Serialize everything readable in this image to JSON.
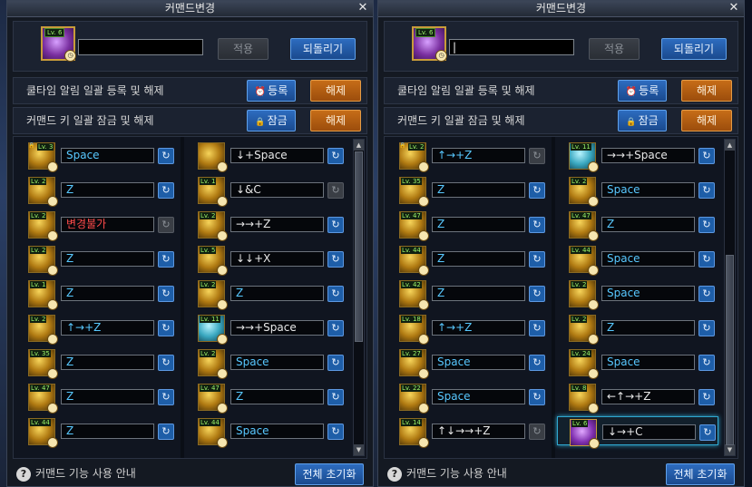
{
  "icons": {
    "close": "✕",
    "reset": "↻",
    "help": "?",
    "alarm": "⏰",
    "lock": "🔒",
    "clock": "◷"
  },
  "panels": [
    {
      "title": "커맨드변경",
      "avatar_level": "Lv. 6",
      "name_value": "",
      "apply_label": "적용",
      "revert_label": "되돌리기",
      "cooldown_label": "쿨타임 알림 일괄 등록 및 해제",
      "register_label": "등록",
      "unregister_label": "해제",
      "lock_row_label": "커맨드 키 일괄 잠금 및 해제",
      "lock_label": "잠금",
      "unlock_label": "해제",
      "help_label": "커맨드 기능 사용 안내",
      "reset_all_label": "전체 초기화",
      "entries": [
        {
          "lv": "Lv. 3",
          "lock": true,
          "cmd": "Space",
          "color": "cyan",
          "active": true,
          "icon": "gold"
        },
        {
          "lv": "",
          "cmd": "↓+Space",
          "color": "white",
          "active": true,
          "icon": "gold"
        },
        {
          "lv": "Lv. 2",
          "cmd": "Z",
          "color": "cyan",
          "active": true,
          "icon": "gold"
        },
        {
          "lv": "Lv. 1",
          "cmd": "↓&C",
          "color": "white",
          "active": false,
          "icon": "gold"
        },
        {
          "lv": "Lv. 2",
          "cmd": "변경불가",
          "color": "red",
          "active": false,
          "icon": "gold"
        },
        {
          "lv": "Lv. 2",
          "cmd": "→→+Z",
          "color": "white",
          "active": true,
          "icon": "gold"
        },
        {
          "lv": "Lv. 2",
          "cmd": "Z",
          "color": "cyan",
          "active": true,
          "icon": "gold"
        },
        {
          "lv": "Lv. 5",
          "cmd": "↓↓+X",
          "color": "white",
          "active": true,
          "icon": "gold"
        },
        {
          "lv": "Lv. 1",
          "cmd": "Z",
          "color": "cyan",
          "active": true,
          "icon": "gold"
        },
        {
          "lv": "Lv. 2",
          "cmd": "Z",
          "color": "cyan",
          "active": true,
          "icon": "gold"
        },
        {
          "lv": "Lv. 2",
          "cmd": "↑→+Z",
          "color": "cyan",
          "active": true,
          "icon": "gold"
        },
        {
          "lv": "Lv. 11",
          "cmd": "→→+Space",
          "color": "white",
          "active": true,
          "icon": "cyan"
        },
        {
          "lv": "Lv. 35",
          "cmd": "Z",
          "color": "cyan",
          "active": true,
          "icon": "gold"
        },
        {
          "lv": "Lv. 2",
          "cmd": "Space",
          "color": "cyan",
          "active": true,
          "icon": "gold"
        },
        {
          "lv": "Lv. 47",
          "cmd": "Z",
          "color": "cyan",
          "active": true,
          "icon": "gold"
        },
        {
          "lv": "Lv. 47",
          "cmd": "Z",
          "color": "cyan",
          "active": true,
          "icon": "gold"
        },
        {
          "lv": "Lv. 44",
          "cmd": "Z",
          "color": "cyan",
          "active": true,
          "icon": "gold"
        },
        {
          "lv": "Lv. 44",
          "cmd": "Space",
          "color": "cyan",
          "active": true,
          "icon": "gold"
        }
      ],
      "scroll_position": 0.0
    },
    {
      "title": "커맨드변경",
      "avatar_level": "Lv. 6",
      "name_value": "|",
      "apply_label": "적용",
      "revert_label": "되돌리기",
      "cooldown_label": "쿨타임 알림 일괄 등록 및 해제",
      "register_label": "등록",
      "unregister_label": "해제",
      "lock_row_label": "커맨드 키 일괄 잠금 및 해제",
      "lock_label": "잠금",
      "unlock_label": "해제",
      "help_label": "커맨드 기능 사용 안내",
      "reset_all_label": "전체 초기화",
      "entries": [
        {
          "lv": "Lv. 2",
          "lock": true,
          "cmd": "↑→+Z",
          "color": "cyan",
          "active": false,
          "icon": "gold"
        },
        {
          "lv": "Lv. 11",
          "cmd": "→→+Space",
          "color": "white",
          "active": true,
          "icon": "cyan"
        },
        {
          "lv": "Lv. 35",
          "cmd": "Z",
          "color": "cyan",
          "active": true,
          "icon": "gold"
        },
        {
          "lv": "Lv. 2",
          "cmd": "Space",
          "color": "cyan",
          "active": true,
          "icon": "gold"
        },
        {
          "lv": "Lv. 47",
          "cmd": "Z",
          "color": "cyan",
          "active": true,
          "icon": "gold"
        },
        {
          "lv": "Lv. 47",
          "cmd": "Z",
          "color": "cyan",
          "active": true,
          "icon": "gold"
        },
        {
          "lv": "Lv. 44",
          "cmd": "Z",
          "color": "cyan",
          "active": true,
          "icon": "gold"
        },
        {
          "lv": "Lv. 44",
          "cmd": "Space",
          "color": "cyan",
          "active": true,
          "icon": "gold"
        },
        {
          "lv": "Lv. 42",
          "cmd": "Z",
          "color": "cyan",
          "active": true,
          "icon": "gold"
        },
        {
          "lv": "Lv. 2",
          "cmd": "Space",
          "color": "cyan",
          "active": true,
          "icon": "gold"
        },
        {
          "lv": "Lv. 18",
          "cmd": "↑→+Z",
          "color": "cyan",
          "active": true,
          "icon": "gold"
        },
        {
          "lv": "Lv. 2",
          "cmd": "Z",
          "color": "cyan",
          "active": true,
          "icon": "gold"
        },
        {
          "lv": "Lv. 27",
          "cmd": "Space",
          "color": "cyan",
          "active": true,
          "icon": "gold"
        },
        {
          "lv": "Lv. 24",
          "cmd": "Space",
          "color": "cyan",
          "active": true,
          "icon": "gold"
        },
        {
          "lv": "Lv. 22",
          "cmd": "Space",
          "color": "cyan",
          "active": true,
          "icon": "gold"
        },
        {
          "lv": "Lv. 8",
          "cmd": "←↑→+Z",
          "color": "white",
          "active": true,
          "icon": "gold"
        },
        {
          "lv": "Lv. 14",
          "cmd": "↑↓→→+Z",
          "color": "white",
          "active": false,
          "icon": "gold"
        },
        {
          "lv": "Lv. 6",
          "cmd": "↓→+C",
          "color": "white",
          "active": true,
          "icon": "purple",
          "selected": true
        }
      ],
      "scroll_position": 1.0
    }
  ]
}
